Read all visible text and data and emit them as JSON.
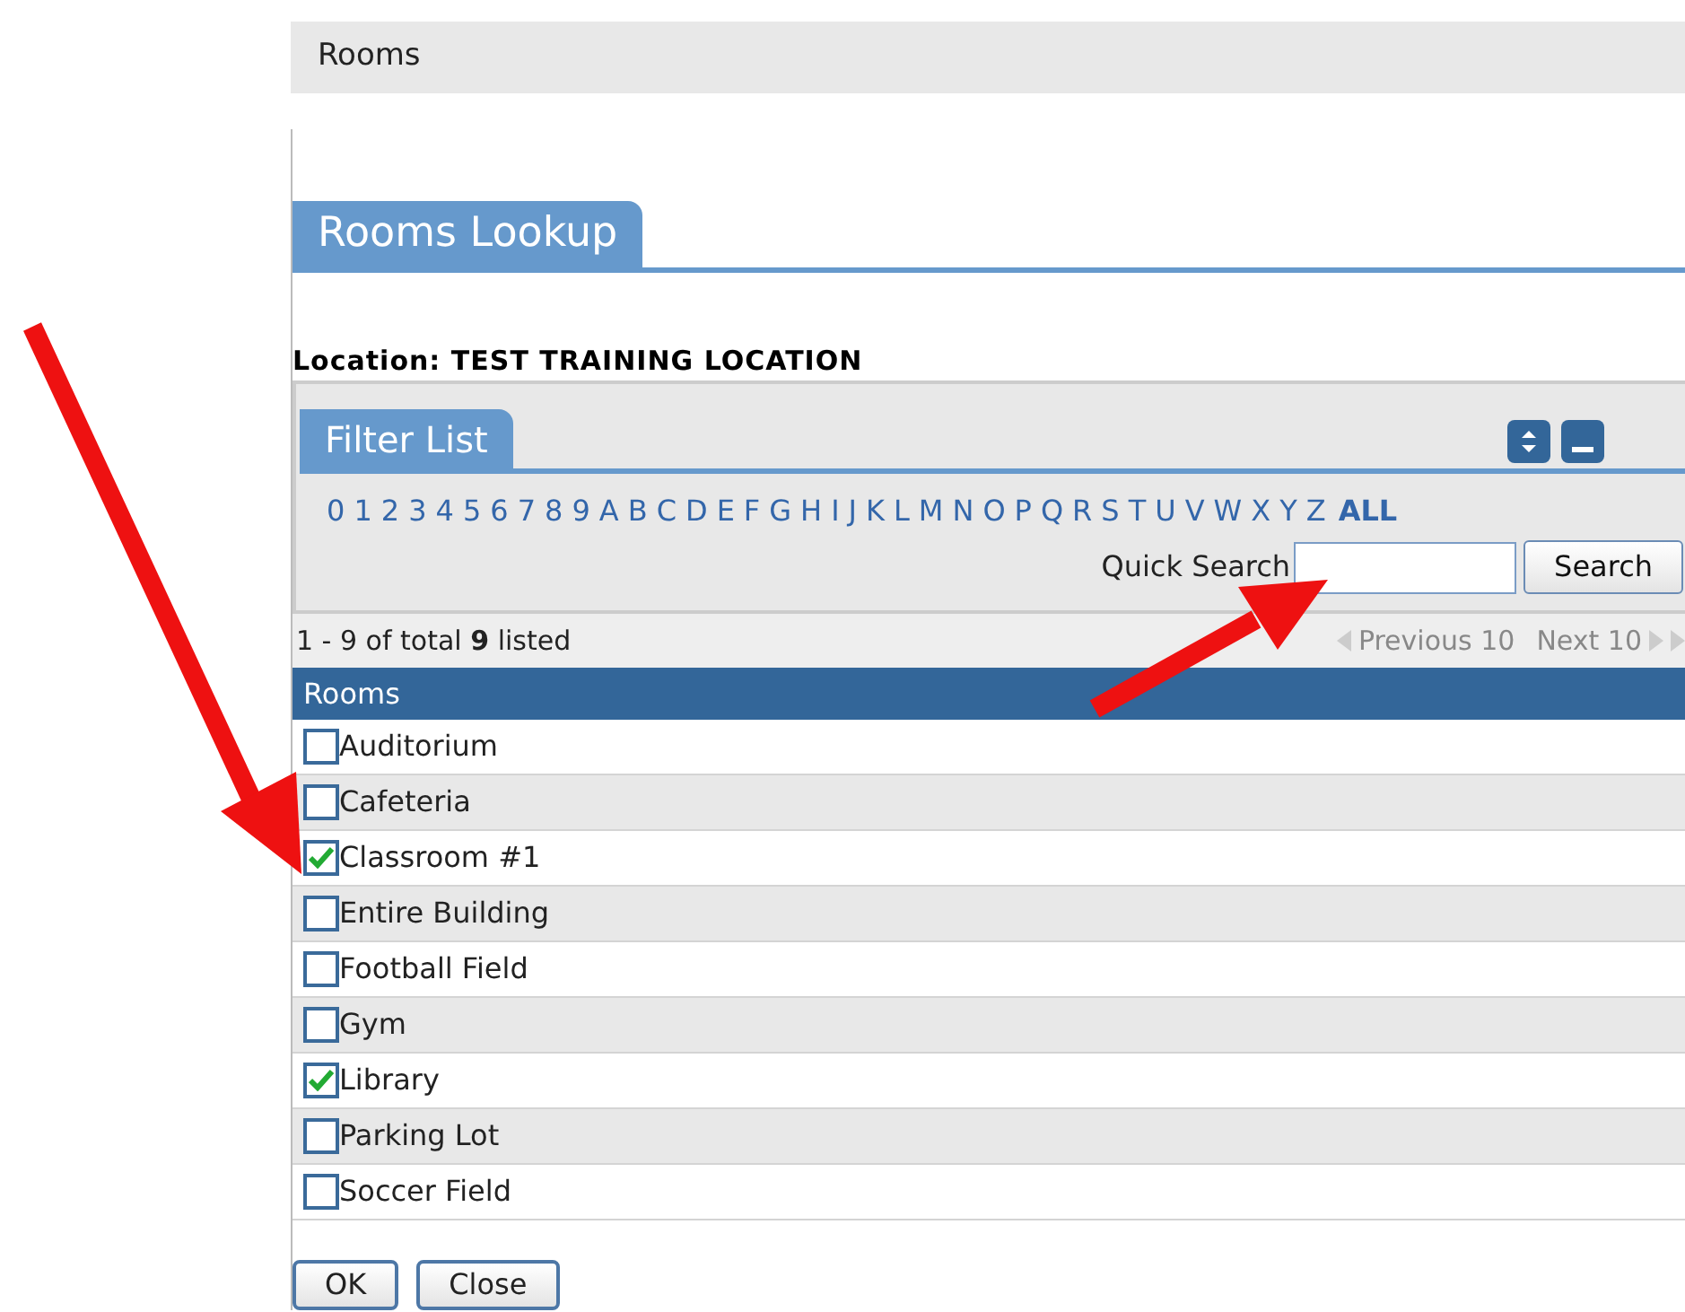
{
  "breadcrumb": "Rooms",
  "lookup_tab": "Rooms Lookup",
  "location": {
    "label": "Location:",
    "value": "TEST TRAINING LOCATION"
  },
  "filter": {
    "tab": "Filter List",
    "index_links": [
      "0",
      "1",
      "2",
      "3",
      "4",
      "5",
      "6",
      "7",
      "8",
      "9",
      "A",
      "B",
      "C",
      "D",
      "E",
      "F",
      "G",
      "H",
      "I",
      "J",
      "K",
      "L",
      "M",
      "N",
      "O",
      "P",
      "Q",
      "R",
      "S",
      "T",
      "U",
      "V",
      "W",
      "X",
      "Y",
      "Z"
    ],
    "all_link": "ALL",
    "quick_search": {
      "label": "Quick Search",
      "button": "Search"
    }
  },
  "pager": {
    "summary": "1 - 9 of total **9** listed",
    "previous": "Previous 10",
    "next": "Next 10"
  },
  "table": {
    "column": "Rooms",
    "rows": [
      {
        "name": "Auditorium",
        "checked": false
      },
      {
        "name": "Cafeteria",
        "checked": false
      },
      {
        "name": "Classroom #1",
        "checked": true
      },
      {
        "name": "Entire Building",
        "checked": false
      },
      {
        "name": "Football Field",
        "checked": false
      },
      {
        "name": "Gym",
        "checked": false
      },
      {
        "name": "Library",
        "checked": true
      },
      {
        "name": "Parking Lot",
        "checked": false
      },
      {
        "name": "Soccer Field",
        "checked": false
      }
    ]
  },
  "buttons": [
    "OK",
    "Close"
  ]
}
